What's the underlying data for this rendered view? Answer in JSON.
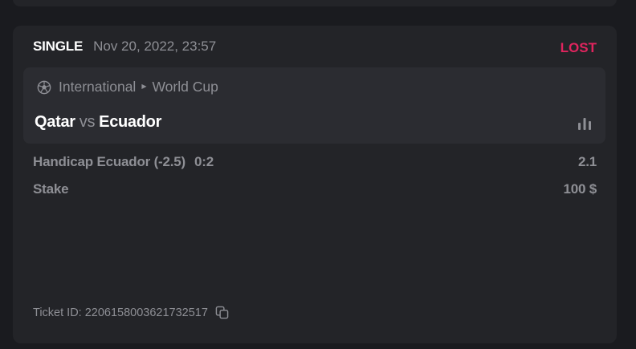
{
  "bet": {
    "type": "SINGLE",
    "date": "Nov 20, 2022, 23:57",
    "status": "LOST",
    "status_color": "#e0245e"
  },
  "event": {
    "sport_icon": "soccer-ball-icon",
    "category": "International",
    "league": "World Cup",
    "home_team": "Qatar",
    "vs": "vs",
    "away_team": "Ecuador",
    "stats_icon": "stats-bars-icon"
  },
  "selection": {
    "market": "Handicap Ecuador (-2.5)",
    "score": "0:2",
    "odds": "2.1"
  },
  "stake": {
    "label": "Stake",
    "value": "100 $"
  },
  "ticket": {
    "label": "Ticket ID: 220615800362173251​7",
    "copy_icon": "copy-icon"
  }
}
